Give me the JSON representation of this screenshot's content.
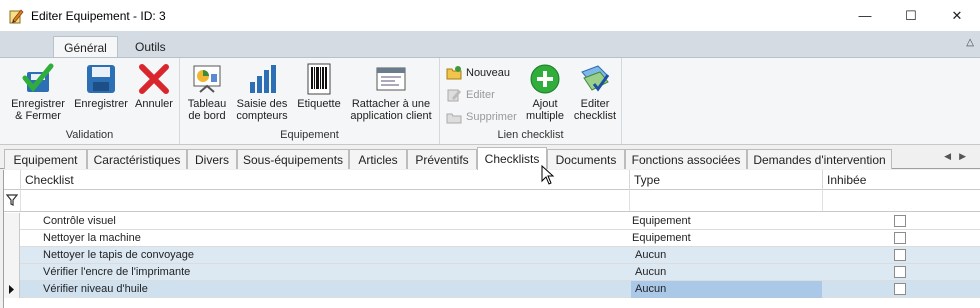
{
  "window": {
    "title": "Editer Equipement - ID: 3",
    "icon": "pencil-notepad-icon",
    "controls": [
      "—",
      "☐",
      "✕"
    ]
  },
  "ribbon": {
    "tabs": [
      "Général",
      "Outils"
    ],
    "active_tab": "Général",
    "groups": {
      "validation": {
        "name": "Validation",
        "buttons": [
          {
            "label": "Enregistrer & Fermer",
            "icon": "save-close-icon"
          },
          {
            "label": "Enregistrer",
            "icon": "floppy-disk-icon"
          },
          {
            "label": "Annuler",
            "icon": "red-x-icon"
          }
        ]
      },
      "equipement": {
        "name": "Equipement",
        "buttons": [
          {
            "label": "Tableau de bord",
            "icon": "dashboard-icon"
          },
          {
            "label": "Saisie des compteurs",
            "icon": "bar-chart-icon"
          },
          {
            "label": "Etiquette",
            "icon": "barcode-icon"
          },
          {
            "label": "Rattacher à une application client",
            "icon": "application-window-icon"
          }
        ]
      },
      "lien_checklist": {
        "name": "Lien checklist",
        "small_buttons": [
          {
            "label": "Nouveau",
            "icon": "folder-new-icon",
            "enabled": true
          },
          {
            "label": "Editer",
            "icon": "edit-icon",
            "enabled": false
          },
          {
            "label": "Supprimer",
            "icon": "delete-icon",
            "enabled": false
          }
        ],
        "buttons": [
          {
            "label": "Ajout multiple",
            "icon": "green-plus-icon"
          },
          {
            "label": "Editer checklist",
            "icon": "checklist-icon"
          }
        ]
      }
    }
  },
  "page_tabs": [
    "Equipement",
    "Caractéristiques",
    "Divers",
    "Sous-équipements",
    "Articles",
    "Préventifs",
    "Checklists",
    "Documents",
    "Fonctions associées",
    "Demandes d'intervention"
  ],
  "active_page_tab": "Checklists",
  "grid": {
    "columns": [
      "Checklist",
      "Type",
      "Inhibée"
    ],
    "rows": [
      {
        "checklist": "Contrôle visuel",
        "type": "Equipement",
        "inhibee": false
      },
      {
        "checklist": "Nettoyer la machine",
        "type": "Equipement",
        "inhibee": false
      },
      {
        "checklist": "Nettoyer le tapis de convoyage",
        "type": "Aucun",
        "inhibee": false
      },
      {
        "checklist": "Vérifier l'encre de l'imprimante",
        "type": "Aucun",
        "inhibee": false
      },
      {
        "checklist": "Vérifier niveau d'huile",
        "type": "Aucun",
        "inhibee": false
      }
    ],
    "selected_row": 4
  },
  "colors": {
    "accent": "#3b82d6",
    "ribbon_bg": "#d4dbe3",
    "row_alt": "#dde9f2"
  }
}
